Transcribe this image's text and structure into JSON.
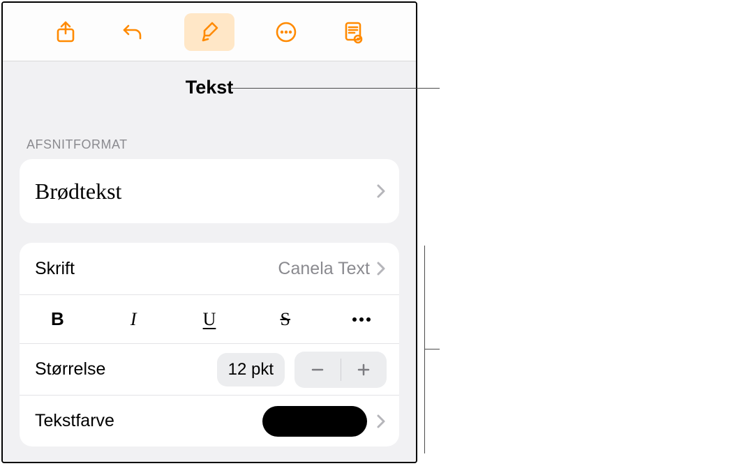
{
  "title": "Tekst",
  "section_label": "AFSNITFORMAT",
  "paragraph_style": {
    "label": "Brødtekst"
  },
  "font_row": {
    "label": "Skrift",
    "value": "Canela Text"
  },
  "style_buttons": {
    "bold": "B",
    "italic": "I",
    "underline": "U",
    "strike": "S"
  },
  "size_row": {
    "label": "Størrelse",
    "value": "12 pkt"
  },
  "color_row": {
    "label": "Tekstfarve",
    "swatch_hex": "#000000"
  }
}
